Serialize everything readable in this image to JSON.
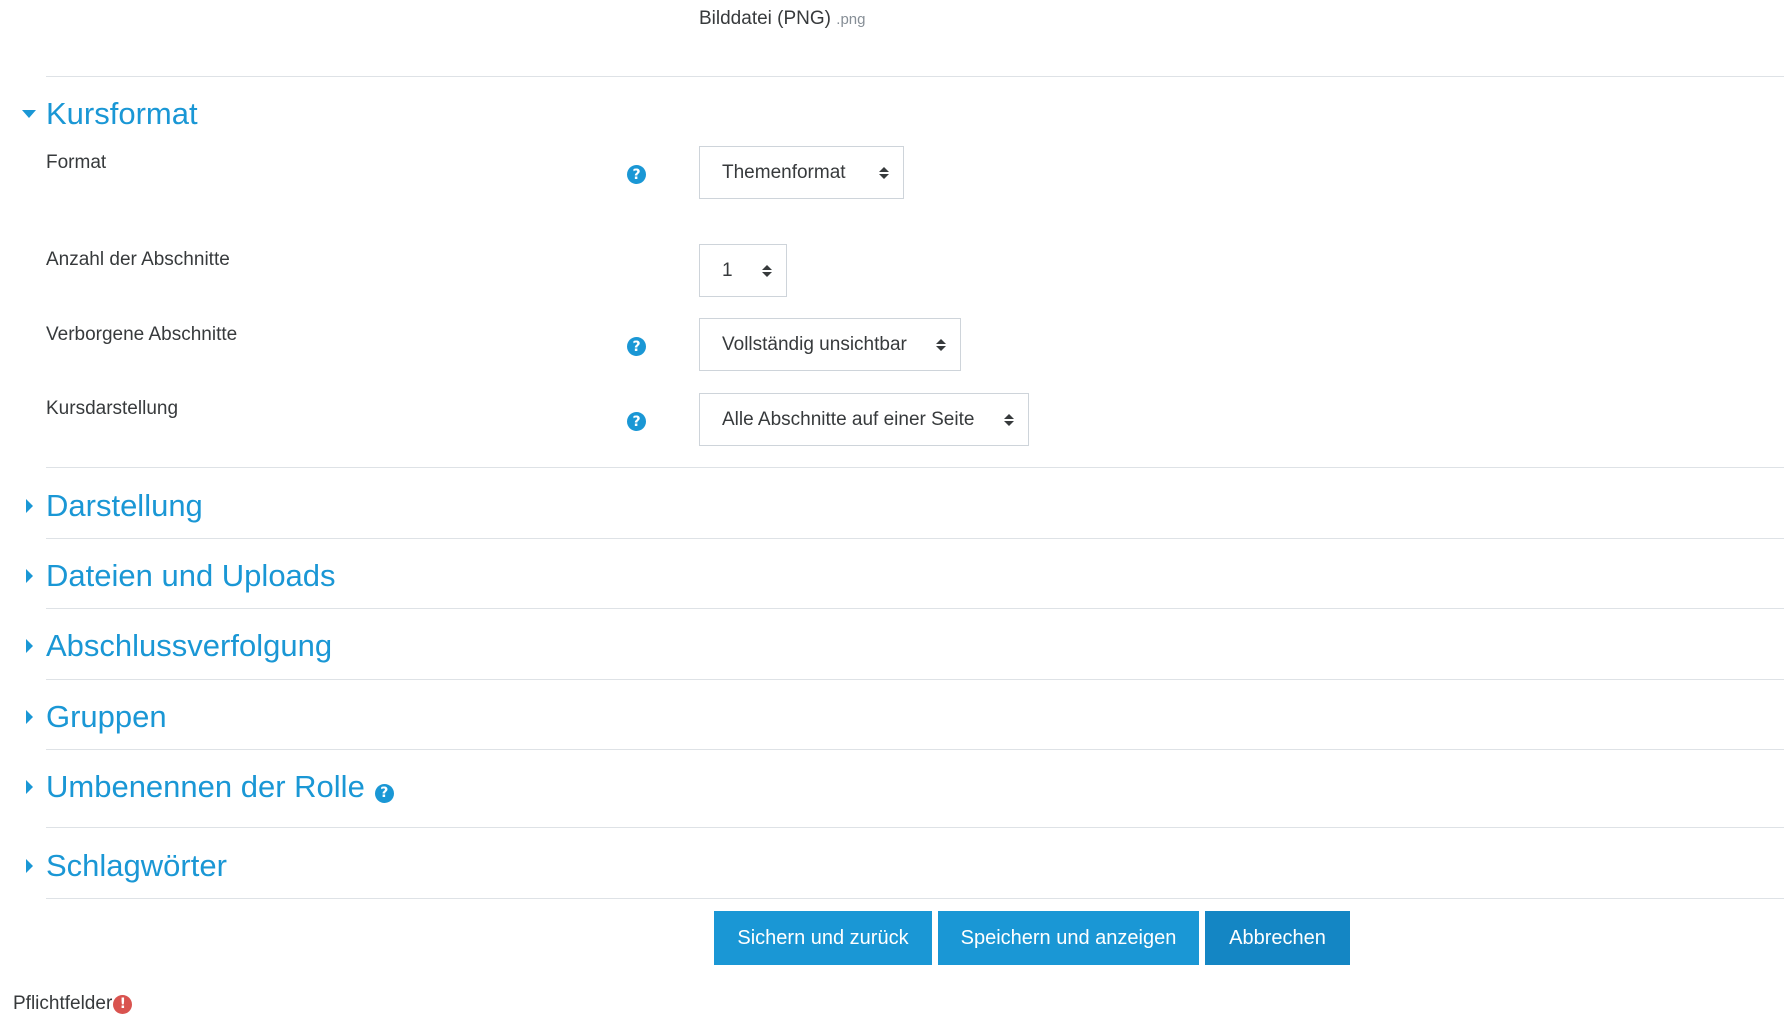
{
  "filetype": {
    "name": "Bilddatei (PNG)",
    "ext": ".png"
  },
  "sections": {
    "kursformat": {
      "title": "Kursformat",
      "expanded": true
    },
    "darstellung": {
      "title": "Darstellung"
    },
    "dateien": {
      "title": "Dateien und Uploads"
    },
    "abschluss": {
      "title": "Abschlussverfolgung"
    },
    "gruppen": {
      "title": "Gruppen"
    },
    "rolle": {
      "title": "Umbenennen der Rolle"
    },
    "schlagwoerter": {
      "title": "Schlagwörter"
    }
  },
  "form": {
    "format": {
      "label": "Format",
      "value": "Themenformat"
    },
    "anzahl": {
      "label": "Anzahl der Abschnitte",
      "value": "1"
    },
    "verborgen": {
      "label": "Verborgene Abschnitte",
      "value": "Vollständig unsichtbar"
    },
    "darstellung": {
      "label": "Kursdarstellung",
      "value": "Alle Abschnitte auf einer Seite"
    }
  },
  "buttons": {
    "save_return": "Sichern und zurück",
    "save_display": "Speichern und anzeigen",
    "cancel": "Abbrechen"
  },
  "required": {
    "label": "Pflichtfelder"
  },
  "icons": {
    "help": "question-circle-icon",
    "required": "exclamation-circle-icon"
  },
  "colors": {
    "accent": "#1a97d5",
    "text": "#373a3c",
    "required": "#d9534f"
  }
}
